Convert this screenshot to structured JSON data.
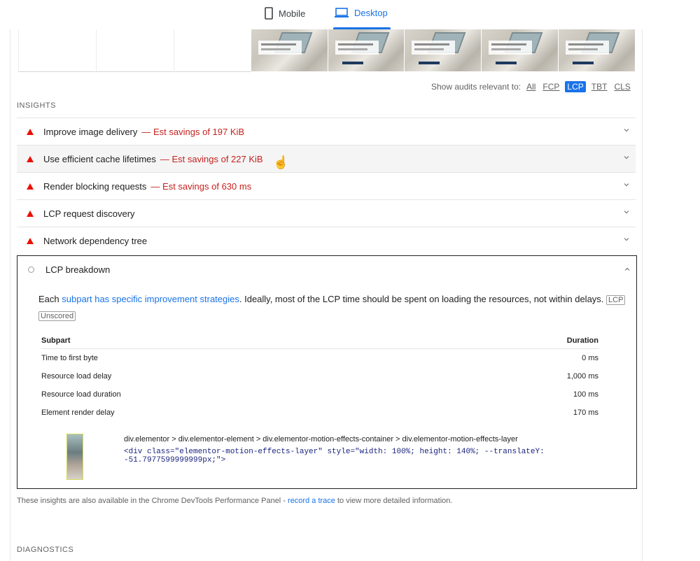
{
  "tabs": {
    "mobile": "Mobile",
    "desktop": "Desktop"
  },
  "filter": {
    "label": "Show audits relevant to:",
    "options": [
      "All",
      "FCP",
      "LCP",
      "TBT",
      "CLS"
    ],
    "active": "LCP"
  },
  "insights": {
    "heading": "INSIGHTS",
    "items": [
      {
        "title": "Improve image delivery",
        "savings": "— Est savings of 197 KiB"
      },
      {
        "title": "Use efficient cache lifetimes",
        "savings": "— Est savings of 227 KiB"
      },
      {
        "title": "Render blocking requests",
        "savings": "— Est savings of 630 ms"
      },
      {
        "title": "LCP request discovery",
        "savings": ""
      },
      {
        "title": "Network dependency tree",
        "savings": ""
      }
    ],
    "expanded": {
      "title": "LCP breakdown",
      "desc_prefix": "Each ",
      "desc_link": "subpart has specific improvement strategies",
      "desc_suffix": ". Ideally, most of the LCP time should be spent on loading the resources, not within delays.",
      "chip_lcp": "LCP",
      "chip_unscored": "Unscored",
      "table": {
        "col_subpart": "Subpart",
        "col_duration": "Duration",
        "rows": [
          {
            "subpart": "Time to first byte",
            "duration": "0 ms"
          },
          {
            "subpart": "Resource load delay",
            "duration": "1,000 ms"
          },
          {
            "subpart": "Resource load duration",
            "duration": "100 ms"
          },
          {
            "subpart": "Element render delay",
            "duration": "170 ms"
          }
        ]
      },
      "node_path": "div.elementor > div.elementor-element > div.elementor-motion-effects-container > div.elementor-motion-effects-layer",
      "node_snippet": "<div class=\"elementor-motion-effects-layer\" style=\"width: 100%; height: 140%; --translateY: -51.7977599999999px;\">"
    },
    "footnote_prefix": "These insights are also available in the Chrome DevTools Performance Panel - ",
    "footnote_link": "record a trace",
    "footnote_suffix": " to view more detailed information."
  },
  "diagnostics": {
    "heading": "DIAGNOSTICS"
  },
  "colors": {
    "accent": "#1a73e8",
    "fail": "#eb0f00",
    "savings": "#c5221f"
  }
}
